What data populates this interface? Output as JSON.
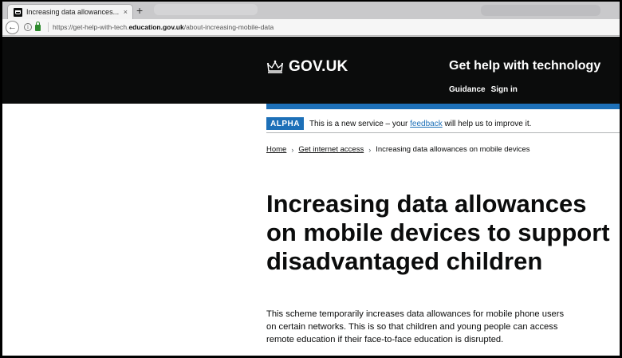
{
  "browser": {
    "tab_title": "Increasing data allowances...",
    "tab_close": "×",
    "new_tab": "+",
    "url_prefix": "https://get-help-with-tech.",
    "url_domain": "education.gov.uk",
    "url_path": "/about-increasing-mobile-data"
  },
  "header": {
    "logo_text": "GOV.UK",
    "service_name": "Get help with technology",
    "nav": [
      "Guidance",
      "Sign in"
    ]
  },
  "phase_banner": {
    "tag": "ALPHA",
    "text_before": "This is a new service – your ",
    "link": "feedback",
    "text_after": " will help us to improve it."
  },
  "breadcrumbs": [
    "Home",
    "Get internet access",
    "Increasing data allowances on mobile devices"
  ],
  "heading_lines": [
    "Increasing data allowances",
    "on mobile devices to support",
    "disadvantaged children"
  ],
  "body_lines": [
    "This scheme temporarily increases data allowances for mobile phone users",
    "on certain networks. This is so that children and young people can access",
    "remote education if their face-to-face education is disrupted."
  ],
  "colors": {
    "header_bg": "#0b0c0c",
    "accent_blue": "#1d70b8",
    "text": "#0b0c0c"
  }
}
